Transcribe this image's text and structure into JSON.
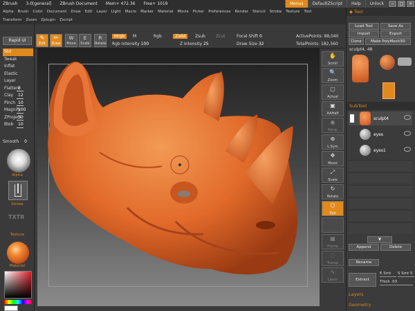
{
  "title_bar": {
    "app": "ZBrush",
    "version": "3.0[general]",
    "document": "ZBrush Document",
    "mem": "Mem+ 472.36",
    "free": "Free+ 1019",
    "menus": "Menus",
    "script": "DefaultZScript",
    "help": "Help",
    "unlock": "Unlock"
  },
  "menu_row1": [
    "Alpha",
    "Brush",
    "Color",
    "Document",
    "Draw",
    "Edit",
    "Layer",
    "Light",
    "Macro",
    "Marker",
    "Material",
    "Movie",
    "Picker",
    "Preferences",
    "Render",
    "Stencil",
    "Stroke",
    "Texture",
    "Tool"
  ],
  "menu_row2": [
    "Transform",
    "Zoom",
    "Zplugin",
    "Zscript"
  ],
  "left": {
    "rapid_ui": "Rapid UI",
    "brushes": [
      {
        "name": "Std",
        "value": ""
      },
      {
        "name": "Tweak",
        "value": ""
      },
      {
        "name": "Inflat",
        "value": ""
      },
      {
        "name": "Elastic",
        "value": ""
      },
      {
        "name": "Layer",
        "value": ""
      },
      {
        "name": "Flatten",
        "value": "8"
      },
      {
        "name": "Clay",
        "value": "12"
      },
      {
        "name": "Pinch",
        "value": "10"
      },
      {
        "name": "Magnify",
        "value": "100"
      },
      {
        "name": "ZProject",
        "value": "50"
      },
      {
        "name": "Blob",
        "value": "10"
      }
    ],
    "smooth_label": "Smooth",
    "smooth_value": "0",
    "alpha_label": "Alpha",
    "stroke_label": "Stroke",
    "txtr_label": "TXTR",
    "texture_label": "Texture",
    "material_label": "Material"
  },
  "toolbar": {
    "edit": "Edit",
    "draw": "Draw",
    "move": "Move",
    "scale": "Scale",
    "rotate": "Rotate",
    "mrgb": "Mrgb",
    "m": "M",
    "rgb": "Rgb",
    "rgb_intensity": "Rgb Intensity",
    "rgb_intensity_value": "100",
    "zadd": "Zadd",
    "zsub": "Zsub",
    "zcut": "Zcut",
    "z_intensity": "Z Intensity",
    "z_intensity_value": "25",
    "focal_shift": "Focal Shift",
    "focal_shift_value": "0",
    "draw_size": "Draw Size",
    "draw_size_value": "32",
    "active_points": "ActivePoints:",
    "active_points_value": "88,040",
    "total_points": "TotalPoints:",
    "total_points_value": "182,560"
  },
  "right_tools": [
    "Scroll",
    "Zoom",
    "Actual",
    "AAHalf",
    "Persp",
    "L.Sym",
    "Move",
    "Scale",
    "Rotate",
    "Xyz",
    "",
    "Frame",
    "Transp",
    "Lasso"
  ],
  "tool_panel": {
    "title": "Tool",
    "load_tool": "Load Tool",
    "save_as": "Save As",
    "import": "Import",
    "export": "Export",
    "clone": "Clone",
    "make_polymesh": "Make PolyMesh3D",
    "current_tool": "sculpt4, 48",
    "subtool_header": "SubTool",
    "subtools": [
      "sculpt4",
      "eyes",
      "eyes1"
    ],
    "append": "Append",
    "delete": "Delete",
    "rename": "Rename",
    "extract": "Extract",
    "e_smt": "E Smt",
    "s_smt": "S Smt",
    "s_smt_value": "5",
    "thick": "Thick",
    "thick_value": ".03",
    "layers": "Layers",
    "geometry": "Geometry"
  },
  "colors": {
    "accent": "#e08a1e",
    "sculpt": "#e06a2a",
    "panel": "#3b3b3b"
  }
}
